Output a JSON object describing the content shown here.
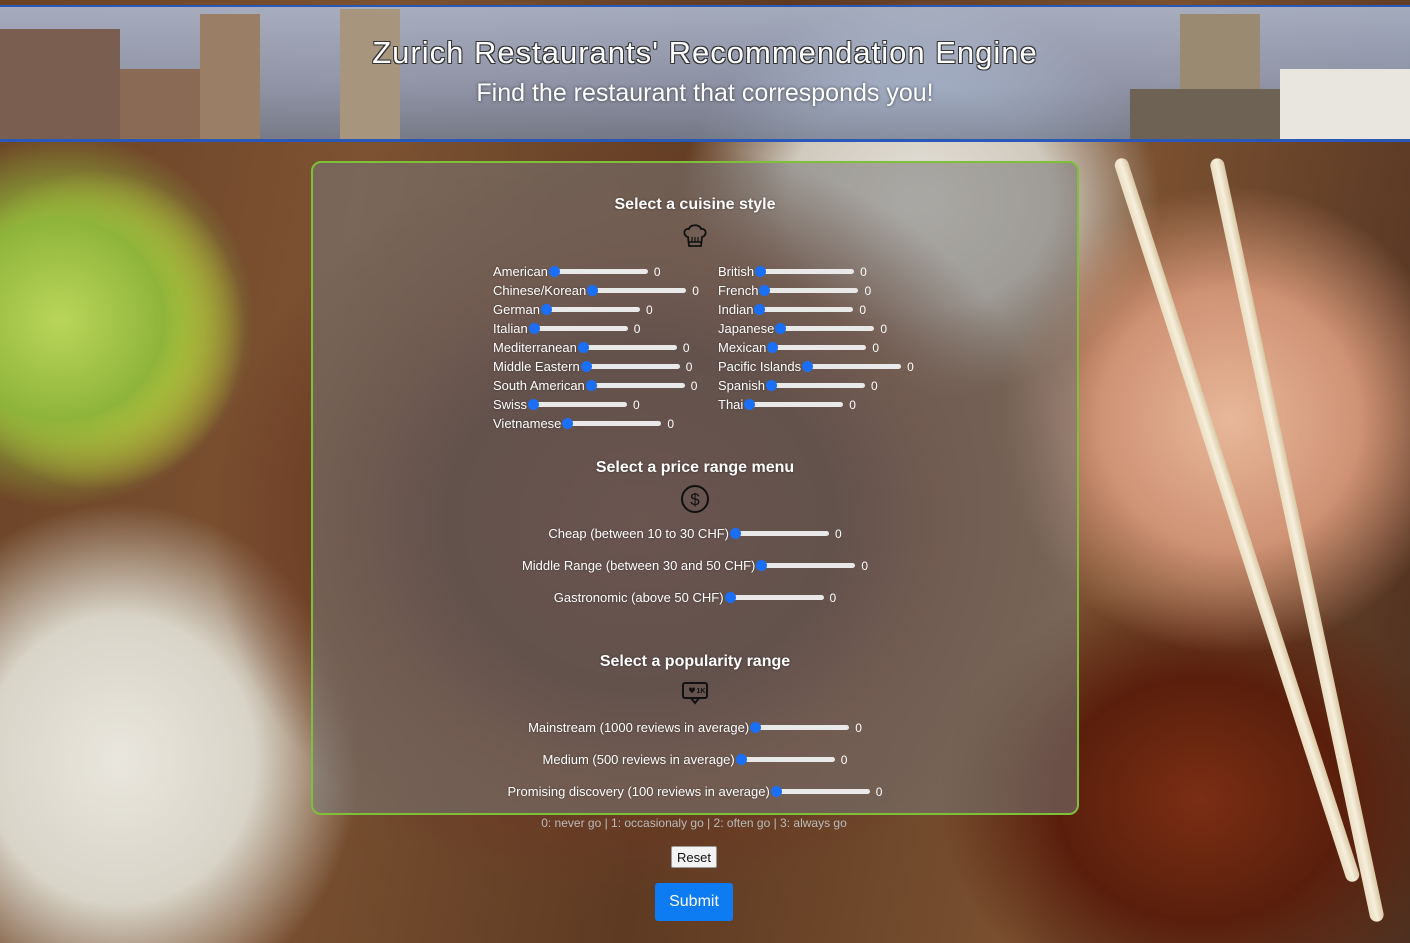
{
  "header": {
    "title": "Zurich Restaurants' Recommendation Engine",
    "subtitle": "Find the restaurant that corresponds you!"
  },
  "cuisine": {
    "title": "Select a cuisine style",
    "icon": "chef-hat-icon",
    "left": [
      {
        "label": "American",
        "value": "0"
      },
      {
        "label": "Chinese/Korean",
        "value": "0"
      },
      {
        "label": "German",
        "value": "0"
      },
      {
        "label": "Italian",
        "value": "0"
      },
      {
        "label": "Mediterranean",
        "value": "0"
      },
      {
        "label": "Middle Eastern",
        "value": "0"
      },
      {
        "label": "South American",
        "value": "0"
      },
      {
        "label": "Swiss",
        "value": "0"
      },
      {
        "label": "Vietnamese",
        "value": "0"
      }
    ],
    "right": [
      {
        "label": "British",
        "value": "0"
      },
      {
        "label": "French",
        "value": "0"
      },
      {
        "label": "Indian",
        "value": "0"
      },
      {
        "label": "Japanese",
        "value": "0"
      },
      {
        "label": "Mexican",
        "value": "0"
      },
      {
        "label": "Pacific Islands",
        "value": "0"
      },
      {
        "label": "Spanish",
        "value": "0"
      },
      {
        "label": "Thai",
        "value": "0"
      }
    ]
  },
  "price": {
    "title": "Select a price range menu",
    "icon": "dollar-circle-icon",
    "items": [
      {
        "label": "Cheap (between 10 to 30 CHF)",
        "value": "0"
      },
      {
        "label": "Middle Range (between 30 and 50 CHF)",
        "value": "0"
      },
      {
        "label": "Gastronomic (above 50 CHF)",
        "value": "0"
      }
    ]
  },
  "popularity": {
    "title": "Select a popularity range",
    "icon": "review-bubble-icon",
    "items": [
      {
        "label": "Mainstream (1000 reviews in average)",
        "value": "0"
      },
      {
        "label": "Medium (500 reviews in average)",
        "value": "0"
      },
      {
        "label": "Promising discovery (100 reviews in average)",
        "value": "0"
      }
    ]
  },
  "hint": "0: never go | 1: occasionaly go | 2: often go | 3: always go",
  "buttons": {
    "reset": "Reset",
    "submit": "Submit"
  },
  "colors": {
    "accent": "#1a6ff5",
    "submit": "#0d7cf2",
    "panel_border": "#7fbf3a",
    "header_border": "#2a58b8"
  }
}
